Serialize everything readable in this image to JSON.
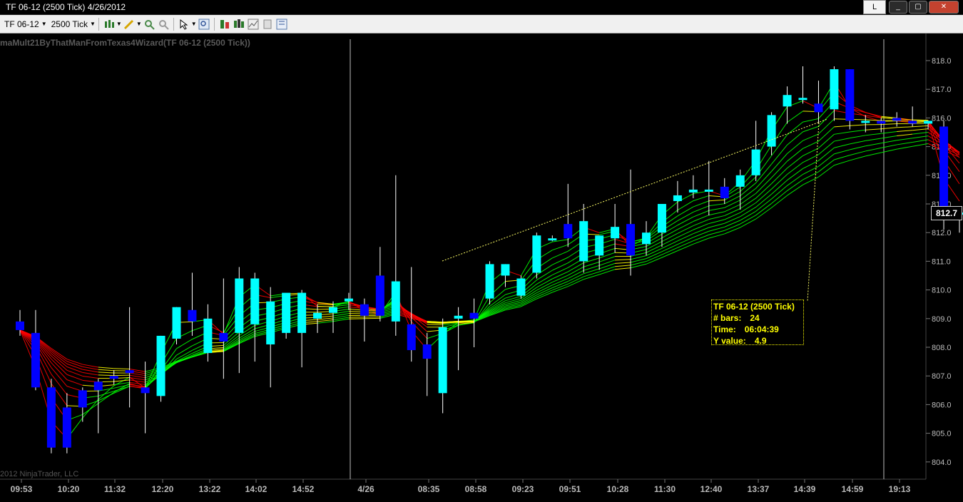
{
  "window": {
    "title": "TF 06-12 (2500 Tick)  4/26/2012",
    "l_button": "L",
    "minimize": "_",
    "maximize": "▢",
    "close": "✕"
  },
  "toolbar": {
    "instrument": "TF 06-12",
    "interval": "2500 Tick"
  },
  "chart": {
    "indicator_label": "maMult21ByThatManFromTexas4Wizard(TF 06-12 (2500 Tick))",
    "copyright": "2012 NinjaTrader, LLC",
    "last_price": "812.7",
    "price_axis": [
      "818.0",
      "817.0",
      "816.0",
      "815.0",
      "814.0",
      "813.0",
      "812.0",
      "811.0",
      "810.0",
      "809.0",
      "808.0",
      "807.0",
      "806.0",
      "805.0",
      "804.0"
    ],
    "time_axis": [
      "09:53",
      "10:20",
      "11:32",
      "12:20",
      "13:22",
      "14:02",
      "14:52",
      "4/26",
      "08:35",
      "08:58",
      "09:23",
      "09:51",
      "10:28",
      "11:30",
      "12:40",
      "13:37",
      "14:39",
      "14:59",
      "19:13"
    ],
    "colors": {
      "bull": "#00ffff",
      "bear": "#0000ff",
      "up_ribbon": "#00ff00",
      "flat_ribbon": "#ffff00",
      "down_ribbon": "#ff0000"
    }
  },
  "tooltip": {
    "line1": "TF 06-12 (2500 Tick)",
    "bars_label": "# bars:",
    "bars_value": "24",
    "time_label": "Time:",
    "time_value": "06:04:39",
    "y_label": "Y value:",
    "y_value": "4.9"
  },
  "chart_data": {
    "type": "candlestick",
    "candles": [
      {
        "o": 808.9,
        "h": 809.3,
        "l": 808.4,
        "c": 808.6
      },
      {
        "o": 808.5,
        "h": 809.3,
        "l": 806.5,
        "c": 806.6
      },
      {
        "o": 806.6,
        "h": 806.9,
        "l": 804.3,
        "c": 804.5
      },
      {
        "o": 805.9,
        "h": 806.4,
        "l": 804.3,
        "c": 804.5
      },
      {
        "o": 806.5,
        "h": 806.6,
        "l": 805.4,
        "c": 805.9
      },
      {
        "o": 806.8,
        "h": 806.9,
        "l": 805.0,
        "c": 806.5
      },
      {
        "o": 807.0,
        "h": 807.2,
        "l": 806.7,
        "c": 806.9
      },
      {
        "o": 807.2,
        "h": 809.4,
        "l": 805.9,
        "c": 807.1
      },
      {
        "o": 806.6,
        "h": 807.5,
        "l": 805.0,
        "c": 806.4
      },
      {
        "o": 806.3,
        "h": 808.4,
        "l": 806.1,
        "c": 808.4
      },
      {
        "o": 808.3,
        "h": 809.4,
        "l": 808.1,
        "c": 809.4
      },
      {
        "o": 809.3,
        "h": 810.6,
        "l": 808.4,
        "c": 808.9
      },
      {
        "o": 807.8,
        "h": 809.5,
        "l": 807.5,
        "c": 809.0
      },
      {
        "o": 808.5,
        "h": 810.4,
        "l": 806.9,
        "c": 808.2
      },
      {
        "o": 808.5,
        "h": 810.8,
        "l": 807.1,
        "c": 810.4
      },
      {
        "o": 808.8,
        "h": 810.6,
        "l": 807.5,
        "c": 810.4
      },
      {
        "o": 808.1,
        "h": 810.1,
        "l": 806.6,
        "c": 809.6
      },
      {
        "o": 808.5,
        "h": 809.5,
        "l": 808.3,
        "c": 809.9
      },
      {
        "o": 808.5,
        "h": 810.0,
        "l": 807.3,
        "c": 809.9
      },
      {
        "o": 809.0,
        "h": 809.5,
        "l": 808.5,
        "c": 809.2
      },
      {
        "o": 809.2,
        "h": 809.6,
        "l": 808.5,
        "c": 809.4
      },
      {
        "o": 809.6,
        "h": 809.9,
        "l": 809.3,
        "c": 809.7
      },
      {
        "o": 809.5,
        "h": 809.7,
        "l": 808.2,
        "c": 809.1
      },
      {
        "o": 810.5,
        "h": 811.5,
        "l": 808.9,
        "c": 809.1
      },
      {
        "o": 808.9,
        "h": 814.0,
        "l": 808.4,
        "c": 810.3
      },
      {
        "o": 808.8,
        "h": 810.8,
        "l": 807.5,
        "c": 807.9
      },
      {
        "o": 808.1,
        "h": 808.5,
        "l": 806.3,
        "c": 807.6
      },
      {
        "o": 806.4,
        "h": 809.0,
        "l": 805.7,
        "c": 808.7
      },
      {
        "o": 809.0,
        "h": 809.4,
        "l": 807.2,
        "c": 809.1
      },
      {
        "o": 809.2,
        "h": 809.7,
        "l": 808.0,
        "c": 809.0
      },
      {
        "o": 809.7,
        "h": 811.0,
        "l": 809.5,
        "c": 810.9
      },
      {
        "o": 810.5,
        "h": 810.9,
        "l": 810.1,
        "c": 810.9
      },
      {
        "o": 809.8,
        "h": 810.5,
        "l": 809.7,
        "c": 810.4
      },
      {
        "o": 810.6,
        "h": 812.0,
        "l": 810.4,
        "c": 811.9
      },
      {
        "o": 811.8,
        "h": 811.9,
        "l": 811.7,
        "c": 811.8
      },
      {
        "o": 812.3,
        "h": 813.7,
        "l": 811.5,
        "c": 811.8
      },
      {
        "o": 811.0,
        "h": 813.0,
        "l": 810.6,
        "c": 812.4
      },
      {
        "o": 811.2,
        "h": 811.8,
        "l": 810.7,
        "c": 811.9
      },
      {
        "o": 811.8,
        "h": 813.0,
        "l": 811.3,
        "c": 812.2
      },
      {
        "o": 812.3,
        "h": 814.2,
        "l": 810.5,
        "c": 811.2
      },
      {
        "o": 811.6,
        "h": 812.4,
        "l": 811.2,
        "c": 812.0
      },
      {
        "o": 812.0,
        "h": 812.8,
        "l": 811.5,
        "c": 813.0
      },
      {
        "o": 813.1,
        "h": 813.8,
        "l": 812.7,
        "c": 813.3
      },
      {
        "o": 813.4,
        "h": 814.0,
        "l": 813.2,
        "c": 813.5
      },
      {
        "o": 813.5,
        "h": 814.5,
        "l": 812.6,
        "c": 813.5
      },
      {
        "o": 813.6,
        "h": 813.9,
        "l": 813.0,
        "c": 813.2
      },
      {
        "o": 813.6,
        "h": 814.2,
        "l": 812.8,
        "c": 814.0
      },
      {
        "o": 814.0,
        "h": 815.9,
        "l": 813.8,
        "c": 814.9
      },
      {
        "o": 815.0,
        "h": 816.2,
        "l": 814.7,
        "c": 816.1
      },
      {
        "o": 816.4,
        "h": 817.1,
        "l": 815.8,
        "c": 816.8
      },
      {
        "o": 816.7,
        "h": 817.8,
        "l": 816.5,
        "c": 816.7
      },
      {
        "o": 816.5,
        "h": 817.3,
        "l": 815.8,
        "c": 816.2
      },
      {
        "o": 816.3,
        "h": 817.8,
        "l": 815.9,
        "c": 817.7
      },
      {
        "o": 817.7,
        "h": 817.7,
        "l": 815.6,
        "c": 815.9
      },
      {
        "o": 815.9,
        "h": 816.1,
        "l": 815.5,
        "c": 815.9
      },
      {
        "o": 815.9,
        "h": 816.0,
        "l": 815.5,
        "c": 815.8
      },
      {
        "o": 816.0,
        "h": 816.2,
        "l": 815.7,
        "c": 815.9
      },
      {
        "o": 815.9,
        "h": 816.4,
        "l": 815.7,
        "c": 815.8
      },
      {
        "o": 815.8,
        "h": 815.9,
        "l": 815.6,
        "c": 815.9
      },
      {
        "o": 815.7,
        "h": 815.9,
        "l": 812.1,
        "c": 812.9
      },
      {
        "o": 812.7,
        "h": 812.9,
        "l": 812.0,
        "c": 812.7
      }
    ]
  }
}
